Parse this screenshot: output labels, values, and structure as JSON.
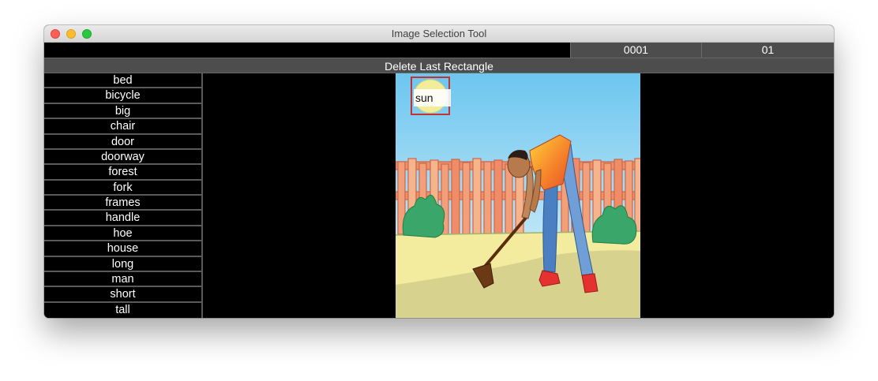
{
  "window": {
    "title": "Image Selection Tool"
  },
  "counters": {
    "image_index": "0001",
    "sub_index": "01"
  },
  "toolbar": {
    "delete_label": "Delete Last Rectangle"
  },
  "words": [
    "bed",
    "bicycle",
    "big",
    "chair",
    "door",
    "doorway",
    "forest",
    "fork",
    "frames",
    "handle",
    "hoe",
    "house",
    "long",
    "man",
    "short",
    "tall"
  ],
  "annotations": [
    {
      "label": "sun"
    }
  ],
  "colors": {
    "sky": "#7ecbef",
    "fence": "#f3a07a",
    "grass": "#f3ec9e",
    "ground": "#d7d28e",
    "bush": "#3aa66a",
    "box": "#c23434"
  }
}
